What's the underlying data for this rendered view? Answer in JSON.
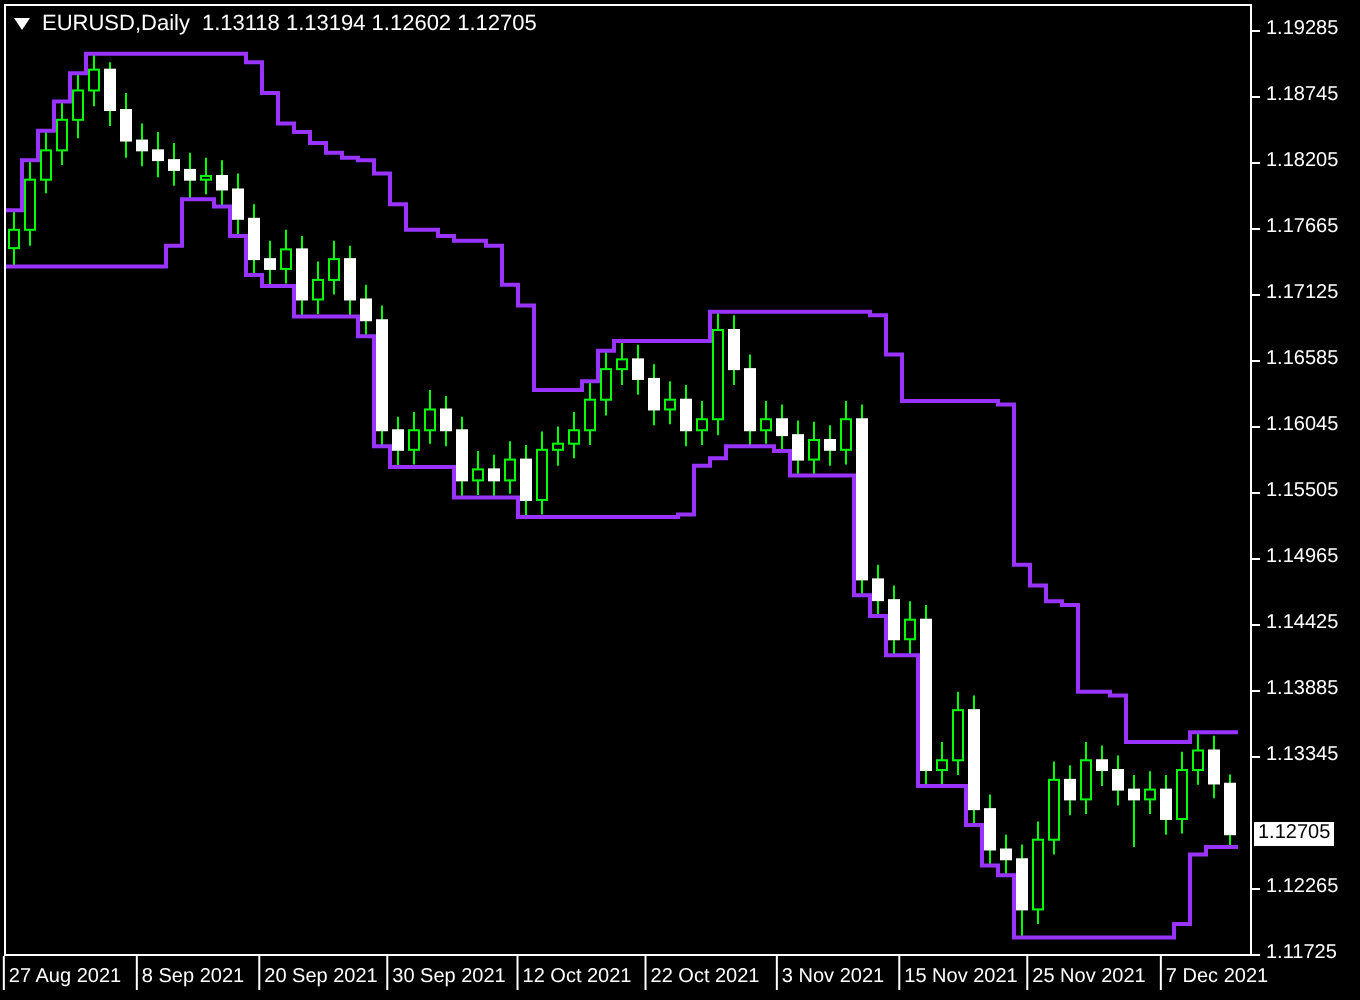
{
  "chart": {
    "symbol_label": "EURUSD,Daily",
    "ohlc_readout": [
      "1.13118",
      "1.13194",
      "1.12602",
      "1.12705"
    ],
    "current_price": "1.12705",
    "chart_data": {
      "type": "candlestick",
      "ylim": [
        1.11725,
        1.19481
      ],
      "yticks": [
        1.19285,
        1.18745,
        1.18205,
        1.17665,
        1.17125,
        1.16585,
        1.16045,
        1.15505,
        1.14965,
        1.14425,
        1.13885,
        1.13345,
        1.12265,
        1.11725
      ],
      "categories": [
        null,
        null,
        null,
        "27 Aug 2021",
        null,
        null,
        null,
        null,
        null,
        null,
        null,
        "8 Sep 2021",
        null,
        null,
        null,
        null,
        null,
        null,
        null,
        "20 Sep 2021",
        null,
        null,
        null,
        null,
        null,
        null,
        null,
        "30 Sep 2021",
        null,
        null,
        null,
        null,
        null,
        null,
        null,
        "12 Oct 2021",
        null,
        null,
        null,
        null,
        null,
        null,
        null,
        "22 Oct 2021",
        null,
        null,
        null,
        null,
        null,
        null,
        null,
        "3 Nov 2021",
        null,
        null,
        null,
        null,
        null,
        null,
        null,
        "15 Nov 2021",
        null,
        null,
        null,
        null,
        null,
        null,
        null,
        "25 Nov 2021",
        null,
        null,
        null,
        null,
        null,
        null,
        null,
        "7 Dec 2021",
        null
      ],
      "ohlc": [
        [
          1.175,
          1.1781,
          1.1735,
          1.1765
        ],
        [
          1.1765,
          1.1822,
          1.1752,
          1.1806
        ],
        [
          1.1806,
          1.1846,
          1.1795,
          1.183
        ],
        [
          1.183,
          1.187,
          1.1818,
          1.1855
        ],
        [
          1.1855,
          1.1893,
          1.184,
          1.1879
        ],
        [
          1.1879,
          1.1909,
          1.1866,
          1.1896
        ],
        [
          1.1896,
          1.1902,
          1.185,
          1.1863
        ],
        [
          1.1863,
          1.1877,
          1.1824,
          1.1838
        ],
        [
          1.1838,
          1.1852,
          1.1817,
          1.183
        ],
        [
          1.183,
          1.1845,
          1.1808,
          1.1822
        ],
        [
          1.1822,
          1.1836,
          1.1801,
          1.1814
        ],
        [
          1.1814,
          1.1828,
          1.179,
          1.1806
        ],
        [
          1.1806,
          1.1824,
          1.1794,
          1.1809
        ],
        [
          1.1809,
          1.1822,
          1.1784,
          1.1798
        ],
        [
          1.1798,
          1.1811,
          1.176,
          1.1774
        ],
        [
          1.1774,
          1.1786,
          1.1728,
          1.1741
        ],
        [
          1.1741,
          1.1756,
          1.1719,
          1.1733
        ],
        [
          1.1733,
          1.1765,
          1.1721,
          1.1749
        ],
        [
          1.1749,
          1.176,
          1.1694,
          1.1708
        ],
        [
          1.1708,
          1.1739,
          1.1696,
          1.1724
        ],
        [
          1.1724,
          1.1756,
          1.1712,
          1.1741
        ],
        [
          1.1741,
          1.1752,
          1.1695,
          1.1708
        ],
        [
          1.1708,
          1.172,
          1.1678,
          1.1691
        ],
        [
          1.1691,
          1.1703,
          1.1588,
          1.1601
        ],
        [
          1.1601,
          1.1612,
          1.1571,
          1.1585
        ],
        [
          1.1585,
          1.1616,
          1.1573,
          1.1601
        ],
        [
          1.1601,
          1.1634,
          1.159,
          1.1618
        ],
        [
          1.1618,
          1.1629,
          1.1588,
          1.1601
        ],
        [
          1.1601,
          1.1612,
          1.1546,
          1.156
        ],
        [
          1.156,
          1.1584,
          1.1548,
          1.1569
        ],
        [
          1.1569,
          1.1581,
          1.1547,
          1.156
        ],
        [
          1.156,
          1.1592,
          1.1549,
          1.1577
        ],
        [
          1.1577,
          1.1589,
          1.153,
          1.1544
        ],
        [
          1.1544,
          1.16,
          1.1532,
          1.1585
        ],
        [
          1.1585,
          1.1604,
          1.1572,
          1.159
        ],
        [
          1.159,
          1.1616,
          1.1578,
          1.1601
        ],
        [
          1.1601,
          1.1641,
          1.1589,
          1.1626
        ],
        [
          1.1626,
          1.1666,
          1.1613,
          1.1651
        ],
        [
          1.1651,
          1.1674,
          1.1638,
          1.1659
        ],
        [
          1.1659,
          1.1671,
          1.163,
          1.1643
        ],
        [
          1.1643,
          1.1655,
          1.1605,
          1.1618
        ],
        [
          1.1618,
          1.1641,
          1.1606,
          1.1626
        ],
        [
          1.1626,
          1.1638,
          1.1588,
          1.1601
        ],
        [
          1.1601,
          1.1625,
          1.1589,
          1.161
        ],
        [
          1.161,
          1.1698,
          1.1597,
          1.1683
        ],
        [
          1.1683,
          1.1695,
          1.1638,
          1.1651
        ],
        [
          1.1651,
          1.1663,
          1.1588,
          1.1601
        ],
        [
          1.1601,
          1.1625,
          1.159,
          1.161
        ],
        [
          1.161,
          1.1622,
          1.1584,
          1.1597
        ],
        [
          1.1597,
          1.1609,
          1.1564,
          1.1577
        ],
        [
          1.1577,
          1.1608,
          1.1565,
          1.1593
        ],
        [
          1.1593,
          1.1605,
          1.1572,
          1.1585
        ],
        [
          1.1585,
          1.1625,
          1.1573,
          1.161
        ],
        [
          1.161,
          1.1622,
          1.1466,
          1.1479
        ],
        [
          1.1479,
          1.1491,
          1.1449,
          1.1462
        ],
        [
          1.1462,
          1.1474,
          1.1417,
          1.143
        ],
        [
          1.143,
          1.1461,
          1.1418,
          1.1446
        ],
        [
          1.1446,
          1.1458,
          1.131,
          1.1323
        ],
        [
          1.1323,
          1.1346,
          1.1311,
          1.1331
        ],
        [
          1.1331,
          1.1387,
          1.1319,
          1.1372
        ],
        [
          1.1372,
          1.1384,
          1.1278,
          1.1291
        ],
        [
          1.1291,
          1.1303,
          1.1245,
          1.1258
        ],
        [
          1.1258,
          1.127,
          1.1237,
          1.125
        ],
        [
          1.125,
          1.1262,
          1.1186,
          1.1209
        ],
        [
          1.1209,
          1.1281,
          1.1197,
          1.1266
        ],
        [
          1.1266,
          1.133,
          1.1254,
          1.1315
        ],
        [
          1.1315,
          1.1327,
          1.1286,
          1.1299
        ],
        [
          1.1299,
          1.1346,
          1.1287,
          1.1331
        ],
        [
          1.1331,
          1.1343,
          1.131,
          1.1323
        ],
        [
          1.1323,
          1.1335,
          1.1294,
          1.1307
        ],
        [
          1.1307,
          1.1319,
          1.126,
          1.1299
        ],
        [
          1.1299,
          1.1322,
          1.1287,
          1.1307
        ],
        [
          1.1307,
          1.1319,
          1.127,
          1.1283
        ],
        [
          1.1283,
          1.1338,
          1.1271,
          1.1323
        ],
        [
          1.1323,
          1.1354,
          1.1311,
          1.1339
        ],
        [
          1.1339,
          1.1351,
          1.13,
          1.1312
        ],
        [
          1.13118,
          1.13194,
          1.12602,
          1.12705
        ]
      ]
    }
  }
}
